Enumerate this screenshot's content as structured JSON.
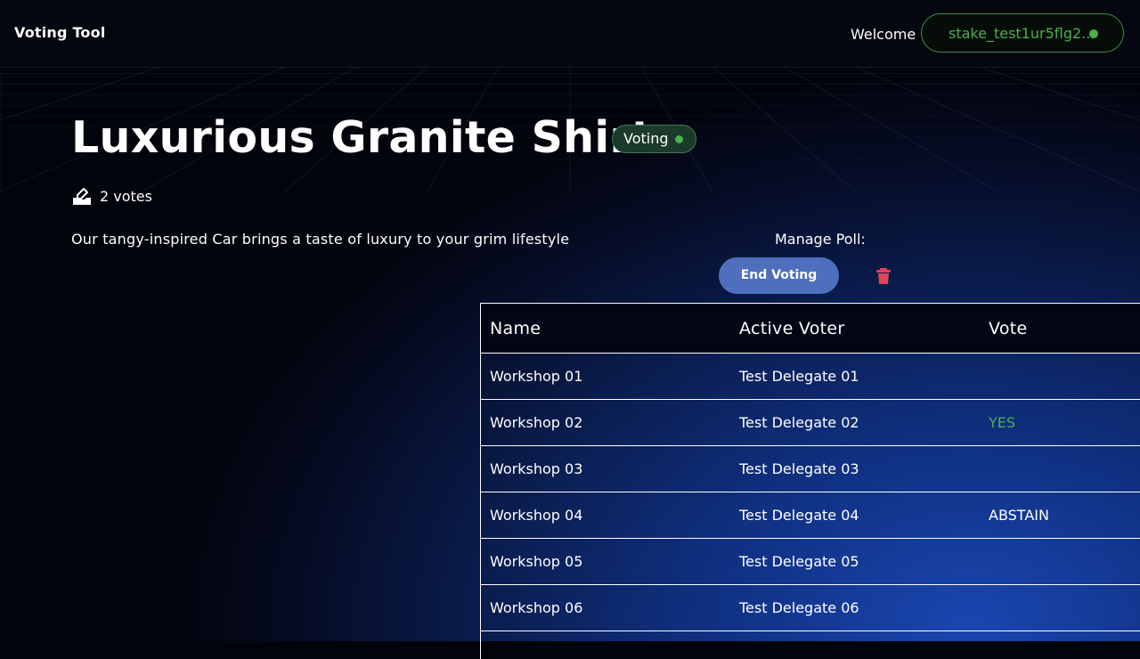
{
  "header": {
    "brand": "Voting Tool",
    "welcome": "Welcome",
    "wallet_address": "stake_test1ur5flg2...",
    "wallet_status_color": "#4caf50"
  },
  "poll": {
    "title": "Luxurious Granite Shirt",
    "status": "Voting",
    "status_color": "#4caf50",
    "votes": "2 votes",
    "description": "Our tangy-inspired Car brings a taste of luxury to your grim lifestyle"
  },
  "manage": {
    "label": "Manage Poll:",
    "end_voting_label": "End Voting",
    "delete_icon": "trash-icon"
  },
  "table": {
    "headers": [
      "Name",
      "Active Voter",
      "Vote"
    ],
    "rows": [
      {
        "name": "Workshop 01",
        "voter": "Test Delegate 01",
        "vote": ""
      },
      {
        "name": "Workshop 02",
        "voter": "Test Delegate 02",
        "vote": "YES"
      },
      {
        "name": "Workshop 03",
        "voter": "Test Delegate 03",
        "vote": ""
      },
      {
        "name": "Workshop 04",
        "voter": "Test Delegate 04",
        "vote": "ABSTAIN"
      },
      {
        "name": "Workshop 05",
        "voter": "Test Delegate 05",
        "vote": ""
      },
      {
        "name": "Workshop 06",
        "voter": "Test Delegate 06",
        "vote": ""
      }
    ],
    "vote_colors": {
      "YES": "#4caf50",
      "ABSTAIN": "#ffffff"
    }
  }
}
